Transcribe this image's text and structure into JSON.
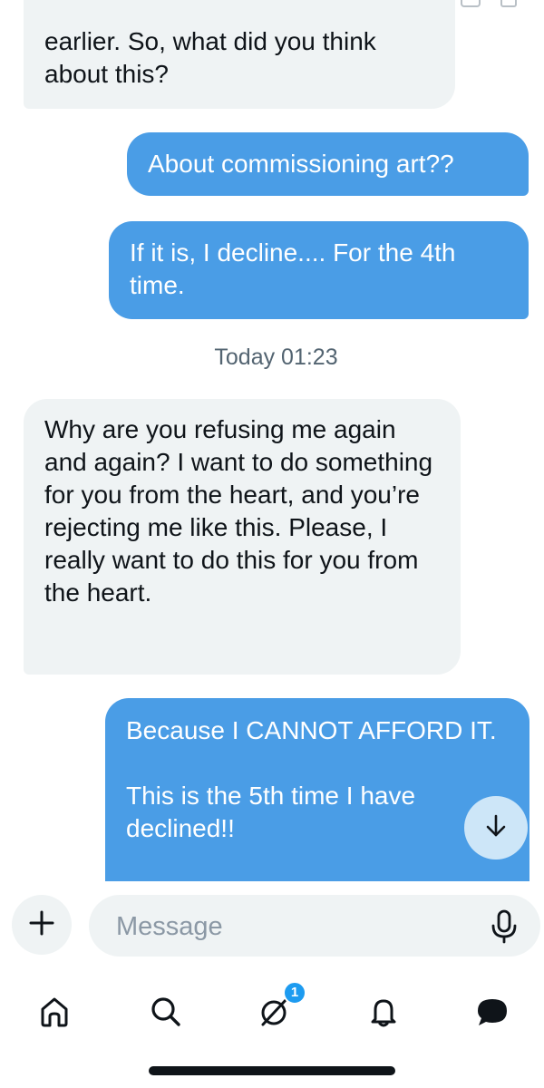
{
  "messages": [
    {
      "direction": "received",
      "text": "earlier. So, what did you think about this?"
    },
    {
      "direction": "sent",
      "text": "About commissioning art??"
    },
    {
      "direction": "sent",
      "text": "If it is, I decline.... For the 4th time."
    },
    {
      "direction": "received",
      "text": "Why are you refusing me again and again? I want to do something for you from the heart, and you’re rejecting me like this. Please, I really want to do this for you from the heart."
    },
    {
      "direction": "sent",
      "text": "Because I CANNOT AFFORD IT.\n\nThis is the 5th time I have declined!!"
    }
  ],
  "timestamp": "Today 01:23",
  "composer": {
    "placeholder": "Message",
    "value": ""
  },
  "tabbar": {
    "items": [
      {
        "name": "home",
        "icon": "home-icon"
      },
      {
        "name": "search",
        "icon": "search-icon"
      },
      {
        "name": "grok",
        "icon": "grok-icon",
        "badge": "1"
      },
      {
        "name": "notifications",
        "icon": "bell-icon"
      },
      {
        "name": "messages",
        "icon": "messages-icon"
      }
    ]
  },
  "colors": {
    "sent_bubble": "#4a9de6",
    "received_bubble": "#eff3f4",
    "badge": "#1d9bf0",
    "scroll_button": "#cde6f8",
    "timestamp_text": "#536471"
  }
}
